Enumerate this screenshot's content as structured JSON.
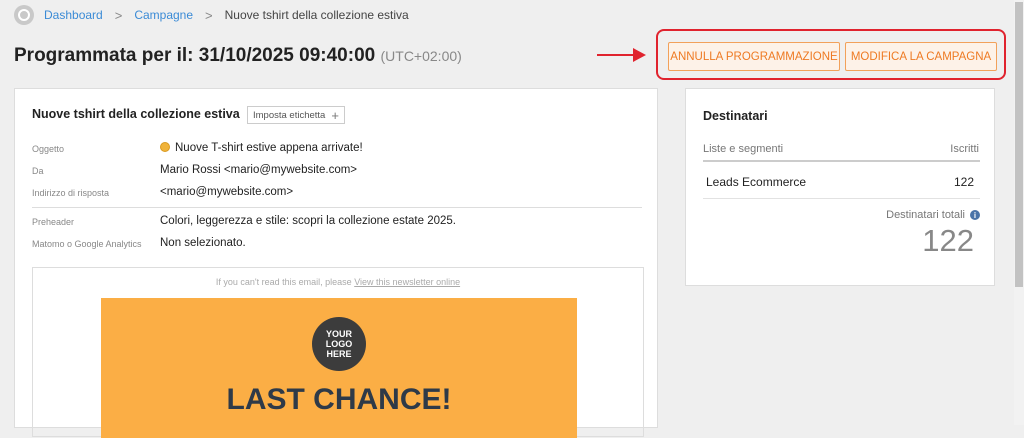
{
  "breadcrumb": {
    "items": [
      "Dashboard",
      "Campagne"
    ],
    "current": "Nuove tshirt della collezione estiva",
    "separator": ">"
  },
  "header": {
    "title": "Programmata per il: 31/10/2025 09:40:00",
    "timezone": "(UTC+02:00)",
    "buttons": {
      "cancel_schedule": "ANNULLA PROGRAMMAZIONE",
      "edit_campaign": "MODIFICA LA CAMPAGNA"
    }
  },
  "campaign": {
    "name": "Nuove tshirt della collezione estiva",
    "tag_button": "Imposta etichetta",
    "tag_plus": "+",
    "fields": [
      {
        "label": "Oggetto",
        "value": "Nuove T-shirt estive appena arrivate!"
      },
      {
        "label": "Da",
        "value": "Mario Rossi <mario@mywebsite.com>"
      },
      {
        "label": "Indirizzo di risposta",
        "value": "<mario@mywebsite.com>"
      },
      {
        "label": "Preheader",
        "value": "Colori, leggerezza e stile: scopri la collezione estate 2025."
      },
      {
        "label": "Matomo o Google Analytics",
        "value": "Non selezionato."
      }
    ],
    "preview": {
      "note": "If you can't read this email, please",
      "note_link": "View this newsletter online",
      "logo_text": "YOUR LOGO HERE",
      "headline": "LAST CHANCE!"
    }
  },
  "recipients": {
    "title": "Destinatari",
    "col_lists": "Liste e segmenti",
    "col_subscribers": "Iscritti",
    "rows": [
      {
        "name": "Leads Ecommerce",
        "count": "122"
      }
    ],
    "total_label": "Destinatari totali",
    "total_value": "122"
  },
  "colors": {
    "accent": "#ee7a23",
    "highlight": "#e0232e",
    "banner": "#fbae45",
    "link": "#3b8bd6"
  }
}
